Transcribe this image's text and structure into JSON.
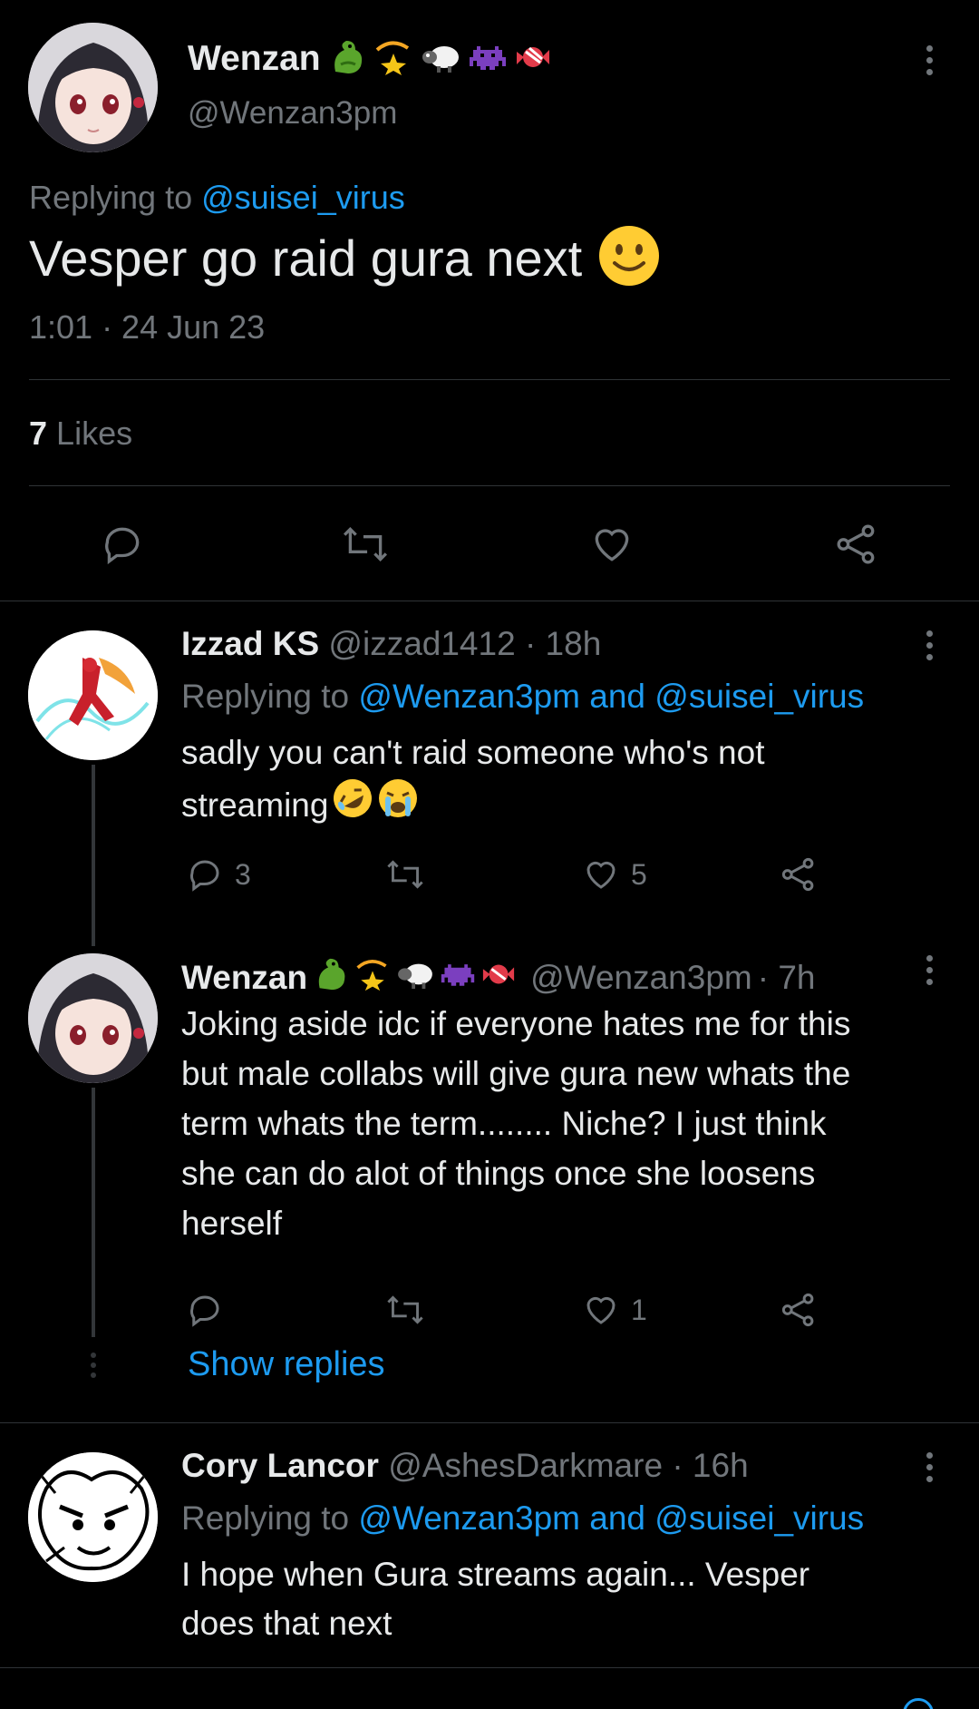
{
  "main_tweet": {
    "name": "Wenzan",
    "handle": "@Wenzan3pm",
    "replying_prefix": "Replying to ",
    "replying_to": "@suisei_virus",
    "text": "Vesper go raid gura next",
    "timestamp": "1:01 · 24 Jun 23",
    "likes_count": "7",
    "likes_label": "Likes"
  },
  "replies": [
    {
      "name": "Izzad KS",
      "handle": "@izzad1412",
      "time": "· 18h",
      "replying_prefix": "Replying to ",
      "replying_to": "@Wenzan3pm and @suisei_virus",
      "text_line1": "sadly you can't raid someone who's not",
      "text_line2": "streaming",
      "reply_count": "3",
      "retweet_count": "",
      "like_count": "5"
    },
    {
      "name": "Wenzan",
      "handle": "@Wenzan3pm",
      "time": "· 7h",
      "text_lines": [
        "Joking aside idc if everyone hates me for this",
        "but male collabs will give gura new whats the",
        "term whats the term........ Niche? I just think",
        "she can do alot of things once she loosens",
        "herself"
      ],
      "reply_count": "",
      "retweet_count": "",
      "like_count": "1",
      "show_replies": "Show replies"
    },
    {
      "name": "Cory Lancor",
      "handle": "@AshesDarkmare",
      "time": "· 16h",
      "replying_prefix": "Replying to ",
      "replying_to": "@Wenzan3pm and @suisei_virus",
      "text_line1": "I hope when Gura streams again... Vesper",
      "text_line2": "does that next"
    }
  ],
  "colors": {
    "accent": "#1d9bf0",
    "muted": "#71767b",
    "background": "#000000",
    "text": "#e7e9ea"
  }
}
